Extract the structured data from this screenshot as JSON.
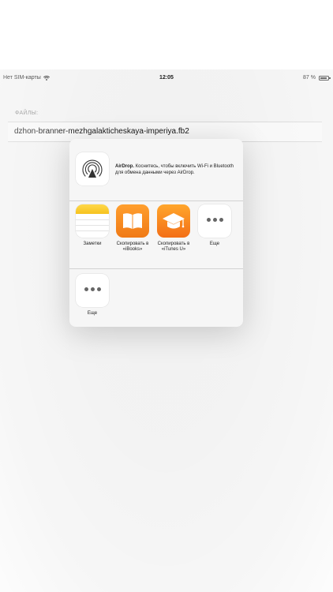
{
  "status_bar": {
    "carrier": "Нет SIM-карты",
    "time": "12:05",
    "battery_percent": "87 %"
  },
  "files": {
    "section_label": "ФАЙЛЫ:",
    "items": [
      "dzhon-branner-mezhgalakticheskaya-imperiya.fb2"
    ]
  },
  "share_sheet": {
    "airdrop": {
      "title": "AirDrop.",
      "description": "Коснитесь, чтобы включить Wi-Fi и Bluetooth для обмена данными через AirDrop."
    },
    "apps": [
      {
        "label": "Заметки",
        "icon": "notes-icon"
      },
      {
        "label": "Скопировать в «iBooks»",
        "icon": "ibooks-icon"
      },
      {
        "label": "Скопировать в «iTunes U»",
        "icon": "itunes-u-icon"
      },
      {
        "label": "Еще",
        "icon": "more-icon"
      }
    ],
    "actions": [
      {
        "label": "Еще",
        "icon": "more-icon"
      }
    ]
  },
  "colors": {
    "ibooks": "#f58a1f",
    "itunes_u": "#f47f1b",
    "notes_header": "#f9cc2e"
  }
}
